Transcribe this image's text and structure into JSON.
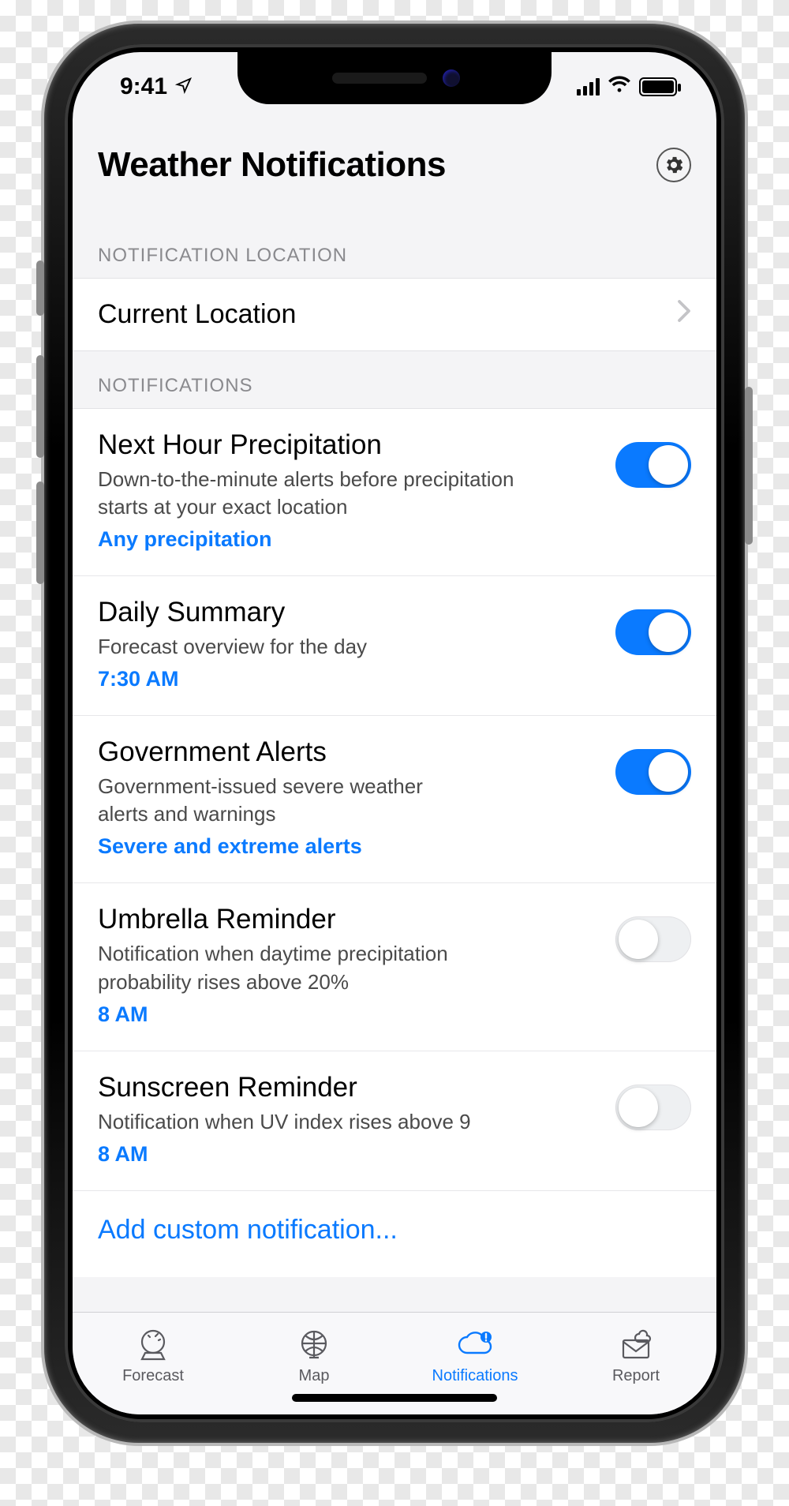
{
  "status": {
    "time": "9:41"
  },
  "header": {
    "title": "Weather Notifications"
  },
  "sections": {
    "location_label": "NOTIFICATION LOCATION",
    "location_value": "Current Location",
    "notifications_label": "NOTIFICATIONS"
  },
  "notifications": [
    {
      "title": "Next Hour Precipitation",
      "desc": "Down-to-the-minute alerts before precipitation starts at your exact location",
      "meta": "Any precipitation",
      "on": true
    },
    {
      "title": "Daily Summary",
      "desc": "Forecast overview for the day",
      "meta": "7:30 AM",
      "on": true
    },
    {
      "title": "Government Alerts",
      "desc": "Government-issued severe weather alerts and warnings",
      "meta": "Severe and extreme alerts",
      "on": true
    },
    {
      "title": "Umbrella Reminder",
      "desc": "Notification when daytime precipitation probability rises above 20%",
      "meta": "8 AM",
      "on": false
    },
    {
      "title": "Sunscreen Reminder",
      "desc": "Notification when UV index rises above 9",
      "meta": "8 AM",
      "on": false
    }
  ],
  "add_row": "Add custom notification...",
  "tabs": {
    "forecast": "Forecast",
    "map": "Map",
    "notifications": "Notifications",
    "report": "Report"
  }
}
